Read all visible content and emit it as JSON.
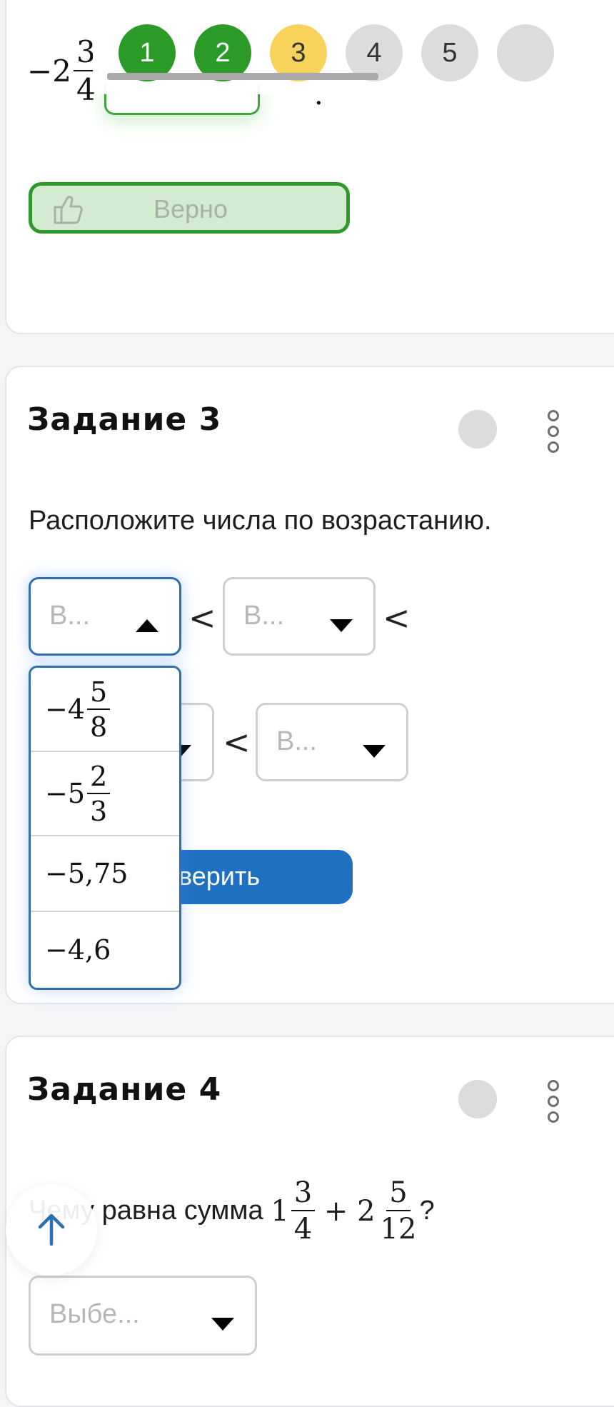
{
  "progress": {
    "steps": [
      {
        "label": "1",
        "state": "done"
      },
      {
        "label": "2",
        "state": "done"
      },
      {
        "label": "3",
        "state": "current"
      },
      {
        "label": "4",
        "state": "todo"
      },
      {
        "label": "5",
        "state": "todo"
      }
    ]
  },
  "task2": {
    "expression": {
      "sign": "−",
      "whole": "2",
      "num": "3",
      "den": "4"
    },
    "trailing": ".",
    "result_label": "Верно"
  },
  "task3": {
    "title": "Задание 3",
    "prompt": "Расположите числа по возрастанию.",
    "select_placeholder": "В...",
    "comparator": "<",
    "options": [
      {
        "sign": "−",
        "whole": "4",
        "num": "5",
        "den": "8"
      },
      {
        "sign": "−",
        "whole": "5",
        "num": "2",
        "den": "3"
      },
      {
        "text": "−5,75"
      },
      {
        "text": "−4,6"
      }
    ],
    "check_button": "верить"
  },
  "task4": {
    "title": "Задание 4",
    "prompt_prefix": "Чему равна сумма",
    "term1": {
      "whole": "1",
      "num": "3",
      "den": "4"
    },
    "plus": "+",
    "term2": {
      "whole": "2",
      "num": "5",
      "den": "12"
    },
    "prompt_suffix": "?",
    "select_placeholder": "Выбе..."
  },
  "colors": {
    "done": "#2b9a26",
    "current": "#f7d35c",
    "todo": "#dcdcdc",
    "primary": "#1f70c1",
    "focus": "#2f6fab",
    "success_bg": "#d3ecd1"
  },
  "icons": {
    "thumbs_up": "thumbs-up-icon",
    "caret_up": "caret-up-icon",
    "caret_down": "caret-down-icon",
    "kebab": "kebab-menu-icon",
    "arrow_up": "arrow-up-icon"
  }
}
